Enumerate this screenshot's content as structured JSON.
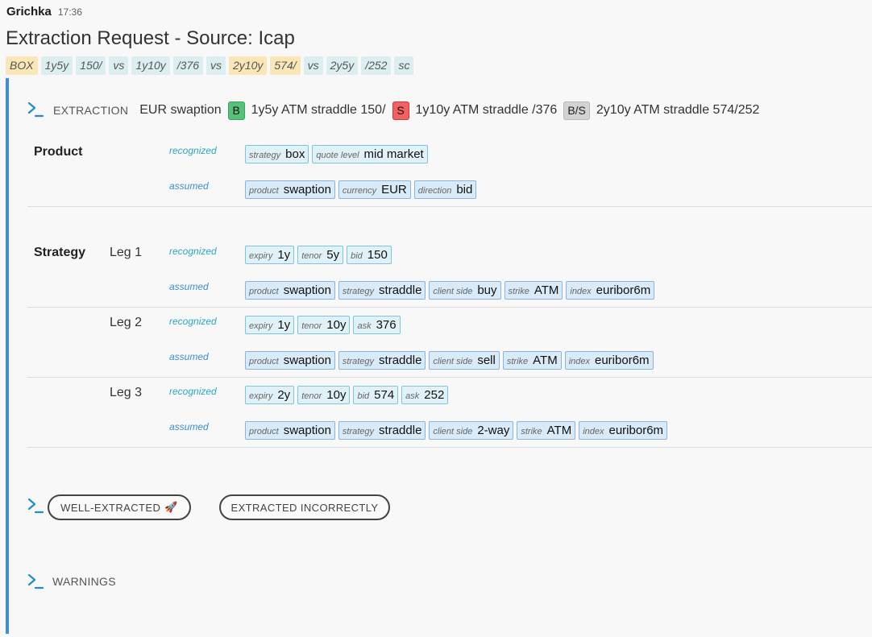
{
  "message": {
    "author": "Grichka",
    "time": "17:36",
    "title": "Extraction Request - Source: Icap"
  },
  "tokens": [
    {
      "text": "BOX",
      "color": "yellow"
    },
    {
      "text": "1y5y",
      "color": "blue"
    },
    {
      "text": "150/",
      "color": "blue"
    },
    {
      "text": "vs",
      "color": "blue"
    },
    {
      "text": "1y10y",
      "color": "blue"
    },
    {
      "text": "/376",
      "color": "blue"
    },
    {
      "text": "vs",
      "color": "blue"
    },
    {
      "text": "2y10y",
      "color": "yellow"
    },
    {
      "text": "574/",
      "color": "yellow"
    },
    {
      "text": "vs",
      "color": "blue"
    },
    {
      "text": "2y5y",
      "color": "blue"
    },
    {
      "text": "/252",
      "color": "blue"
    },
    {
      "text": "sc",
      "color": "blue"
    }
  ],
  "extraction": {
    "label": "EXTRACTION",
    "summary_prefix": "EUR swaption",
    "legs": [
      {
        "dir": "B",
        "text": "1y5y ATM straddle 150/"
      },
      {
        "dir": "S",
        "text": "1y10y ATM straddle /376"
      },
      {
        "dir": "B/S",
        "text": "2y10y ATM straddle 574/252"
      }
    ]
  },
  "labels": {
    "product": "Product",
    "strategy": "Strategy",
    "recognized": "recognized",
    "assumed": "assumed"
  },
  "product": {
    "recognized": [
      {
        "k": "strategy",
        "v": "box"
      },
      {
        "k": "quote level",
        "v": "mid market"
      }
    ],
    "assumed": [
      {
        "k": "product",
        "v": "swaption"
      },
      {
        "k": "currency",
        "v": "EUR"
      },
      {
        "k": "direction",
        "v": "bid"
      }
    ]
  },
  "legs": [
    {
      "label": "Leg 1",
      "recognized": [
        {
          "k": "expiry",
          "v": "1y"
        },
        {
          "k": "tenor",
          "v": "5y"
        },
        {
          "k": "bid",
          "v": "150"
        }
      ],
      "assumed": [
        {
          "k": "product",
          "v": "swaption"
        },
        {
          "k": "strategy",
          "v": "straddle"
        },
        {
          "k": "client side",
          "v": "buy"
        },
        {
          "k": "strike",
          "v": "ATM"
        },
        {
          "k": "index",
          "v": "euribor6m"
        }
      ]
    },
    {
      "label": "Leg 2",
      "recognized": [
        {
          "k": "expiry",
          "v": "1y"
        },
        {
          "k": "tenor",
          "v": "10y"
        },
        {
          "k": "ask",
          "v": "376"
        }
      ],
      "assumed": [
        {
          "k": "product",
          "v": "swaption"
        },
        {
          "k": "strategy",
          "v": "straddle"
        },
        {
          "k": "client side",
          "v": "sell"
        },
        {
          "k": "strike",
          "v": "ATM"
        },
        {
          "k": "index",
          "v": "euribor6m"
        }
      ]
    },
    {
      "label": "Leg 3",
      "recognized": [
        {
          "k": "expiry",
          "v": "2y"
        },
        {
          "k": "tenor",
          "v": "10y"
        },
        {
          "k": "bid",
          "v": "574"
        },
        {
          "k": "ask",
          "v": "252"
        }
      ],
      "assumed": [
        {
          "k": "product",
          "v": "swaption"
        },
        {
          "k": "strategy",
          "v": "straddle"
        },
        {
          "k": "client side",
          "v": "2-way"
        },
        {
          "k": "strike",
          "v": "ATM"
        },
        {
          "k": "index",
          "v": "euribor6m"
        }
      ]
    }
  ],
  "feedback": {
    "well_extracted": "WELL-EXTRACTED",
    "well_extracted_emoji": "🚀",
    "extracted_incorrectly": "EXTRACTED INCORRECTLY"
  },
  "warnings_label": "WARNINGS",
  "colors": {
    "accent_bar": "#3c8dde",
    "chevron": "#1f8fc7",
    "buy": "#57c17a",
    "sell": "#f26060",
    "two_way": "#d3d3d3",
    "recognized_text": "#2aa6c6",
    "assumed_text": "#3a8ed2"
  },
  "icons": {
    "expander": "chevron-right-prompt-icon"
  }
}
